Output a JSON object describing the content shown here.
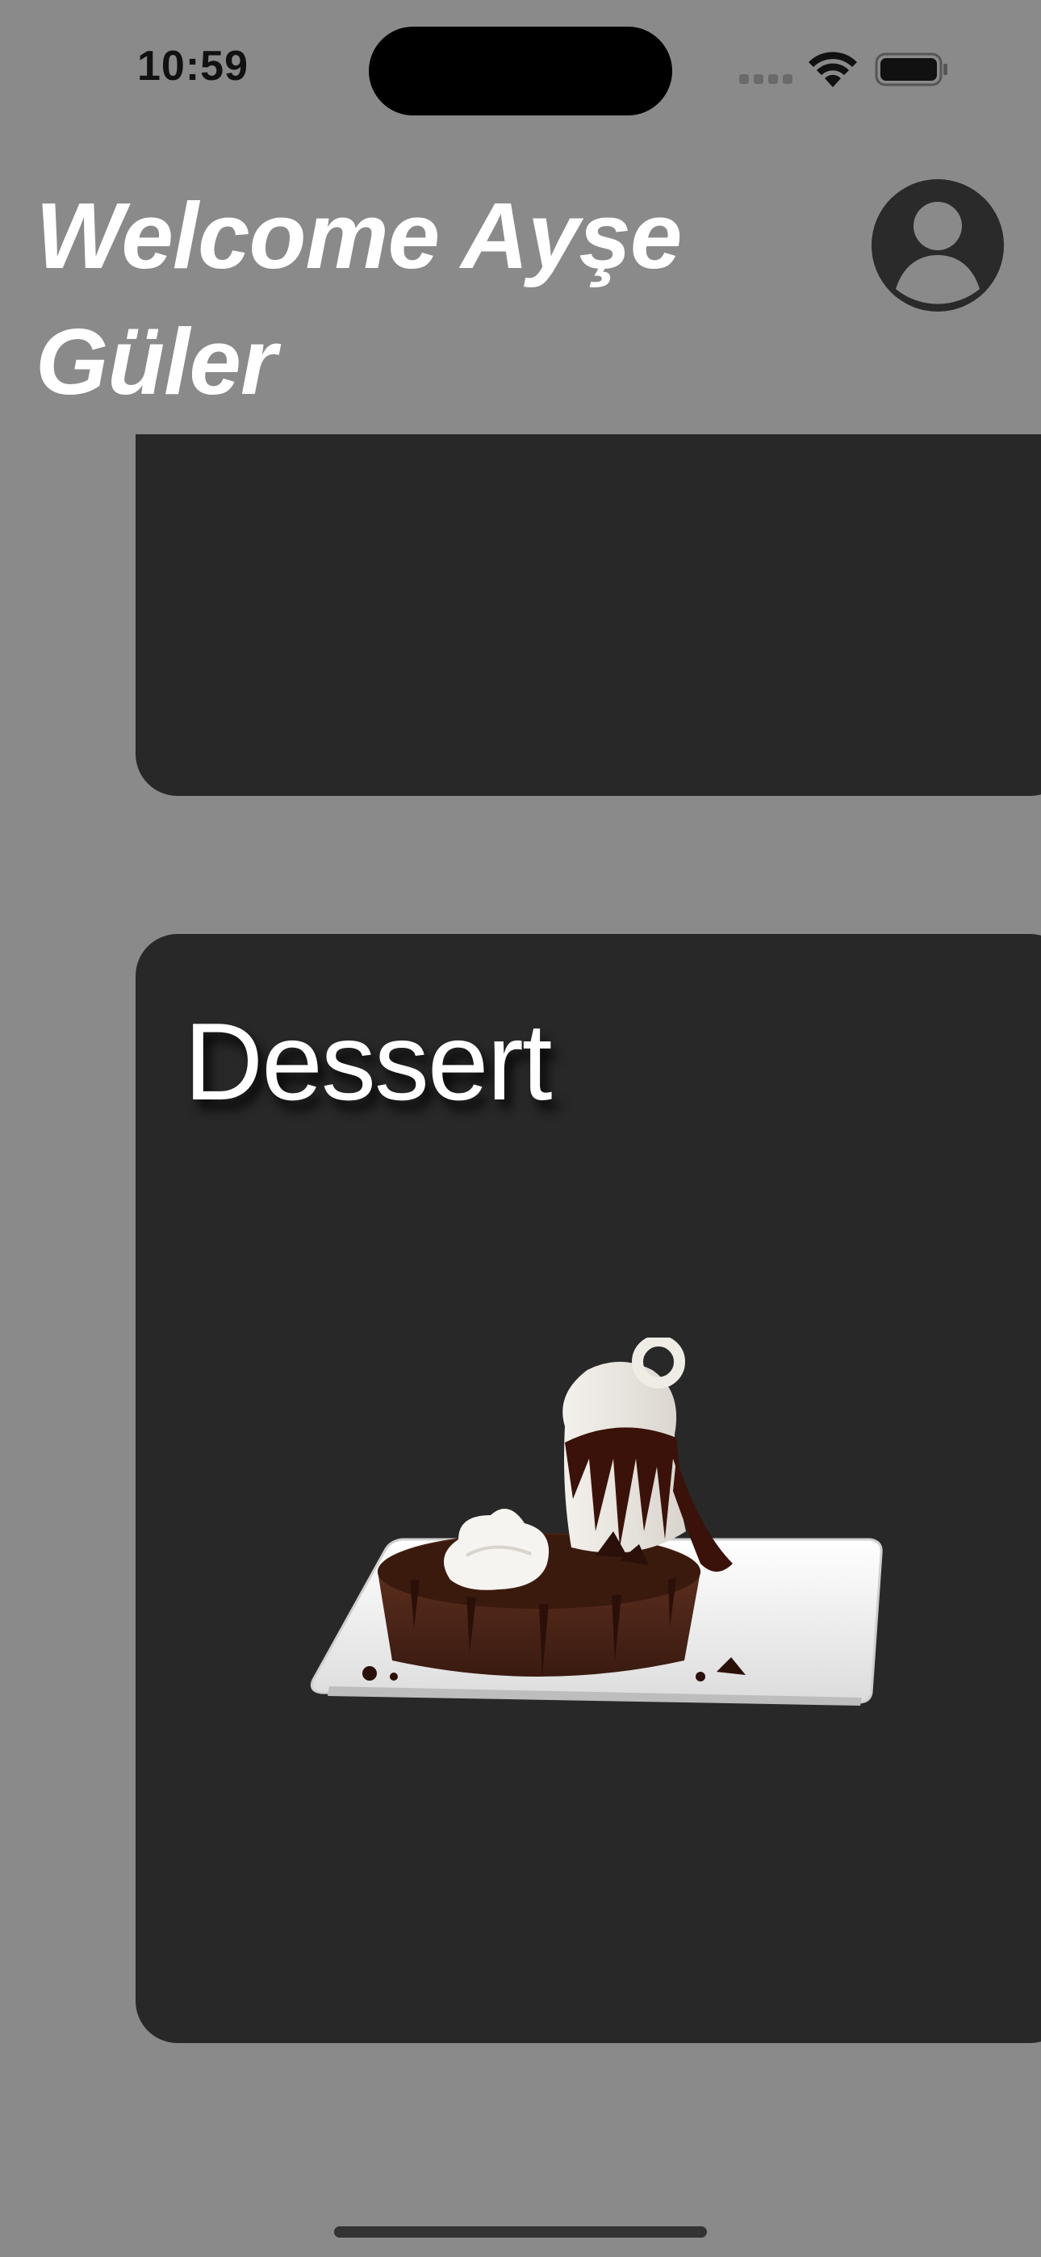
{
  "status_bar": {
    "time": "10:59",
    "icons": [
      "cellular-signal-icon",
      "wifi-icon",
      "battery-icon"
    ]
  },
  "header": {
    "title": "Welcome Ayşe Güler",
    "profile_icon": "person-circle-icon"
  },
  "categories": [
    {
      "label": "",
      "image": "food-plate-image"
    },
    {
      "label": "Dessert",
      "image": "chocolate-lava-cake-with-ice-cream-image"
    }
  ],
  "colors": {
    "background": "#8a8a8a",
    "card": "#282828",
    "title_text": "#ffffff"
  }
}
